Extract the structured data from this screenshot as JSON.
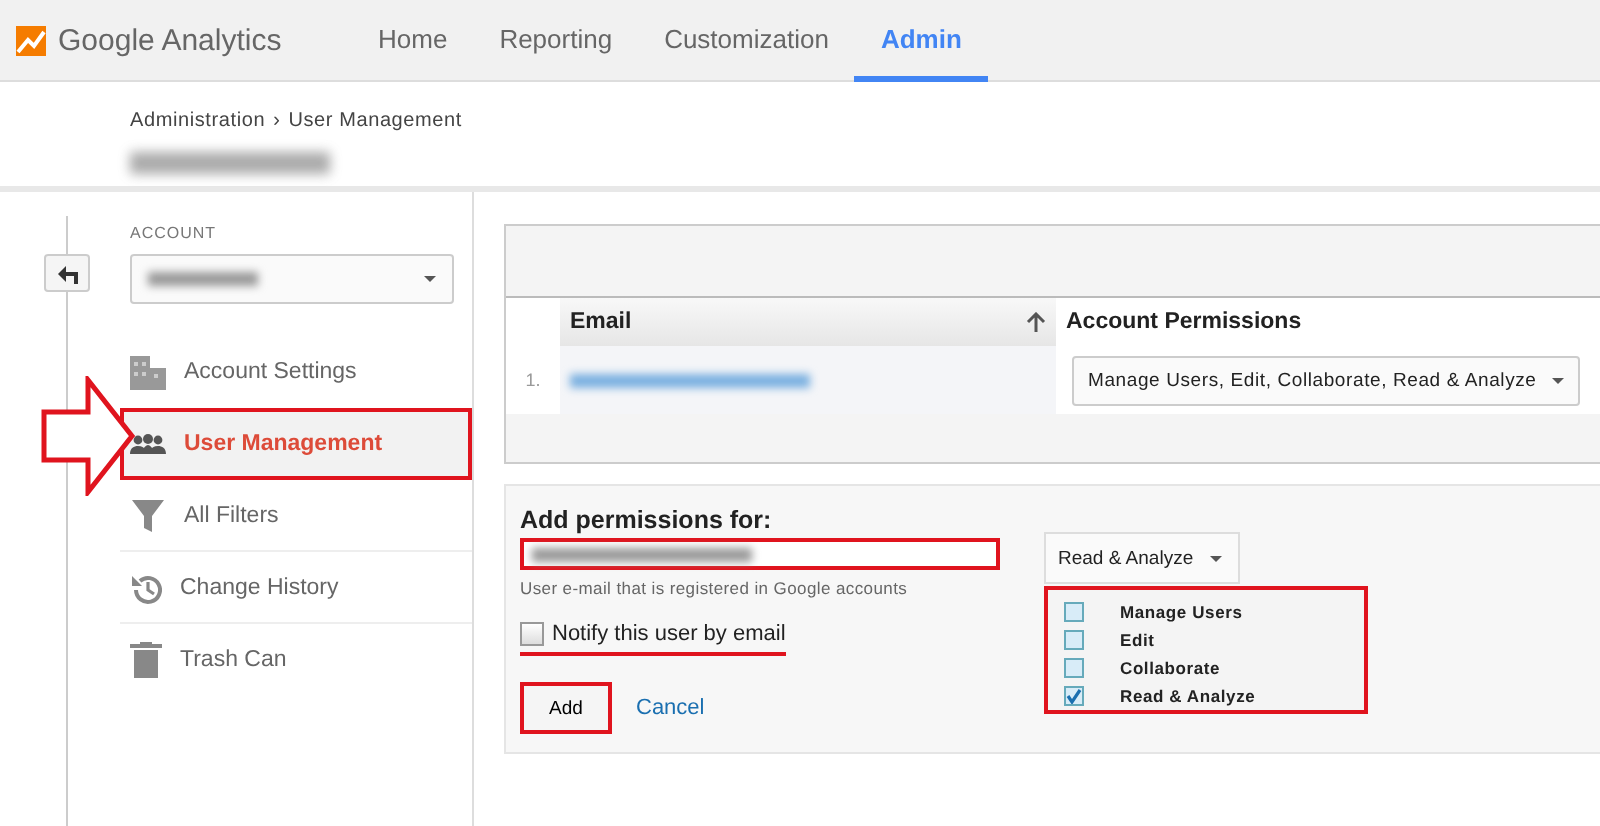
{
  "header": {
    "product": "Google Analytics",
    "tabs": [
      {
        "label": "Home",
        "selected": false
      },
      {
        "label": "Reporting",
        "selected": false
      },
      {
        "label": "Customization",
        "selected": false
      },
      {
        "label": "Admin",
        "selected": true
      }
    ]
  },
  "breadcrumb": {
    "items": [
      "Administration",
      "User Management"
    ],
    "separator": "›"
  },
  "sidebar": {
    "account_label": "ACCOUNT",
    "pointer_arrow": true,
    "items": [
      {
        "label": "Account Settings",
        "kind": "building",
        "selected": false,
        "highlighted": false
      },
      {
        "label": "User Management",
        "kind": "people",
        "selected": true,
        "highlighted": true
      },
      {
        "label": "All Filters",
        "kind": "filter",
        "selected": false,
        "highlighted": false
      },
      {
        "label": "Change History",
        "kind": "history",
        "selected": false,
        "highlighted": false
      },
      {
        "label": "Trash Can",
        "kind": "trash",
        "selected": false,
        "highlighted": false
      }
    ]
  },
  "users_table": {
    "columns": [
      "Email",
      "Account Permissions"
    ],
    "rows": [
      {
        "number": "1.",
        "permissions": "Manage Users, Edit, Collaborate, Read & Analyze"
      }
    ]
  },
  "add_form": {
    "title": "Add permissions for:",
    "email_highlighted": true,
    "hint": "User e-mail that is registered in Google accounts",
    "notify": {
      "label": "Notify this user by email",
      "checked": false,
      "highlighted": true
    },
    "add_button": {
      "label": "Add",
      "highlighted": true
    },
    "cancel": "Cancel",
    "permission_select": "Read & Analyze",
    "menu_highlighted": true,
    "permissions": [
      {
        "label": "Manage Users",
        "checked": false
      },
      {
        "label": "Edit",
        "checked": false
      },
      {
        "label": "Collaborate",
        "checked": false
      },
      {
        "label": "Read & Analyze",
        "checked": true
      }
    ]
  }
}
